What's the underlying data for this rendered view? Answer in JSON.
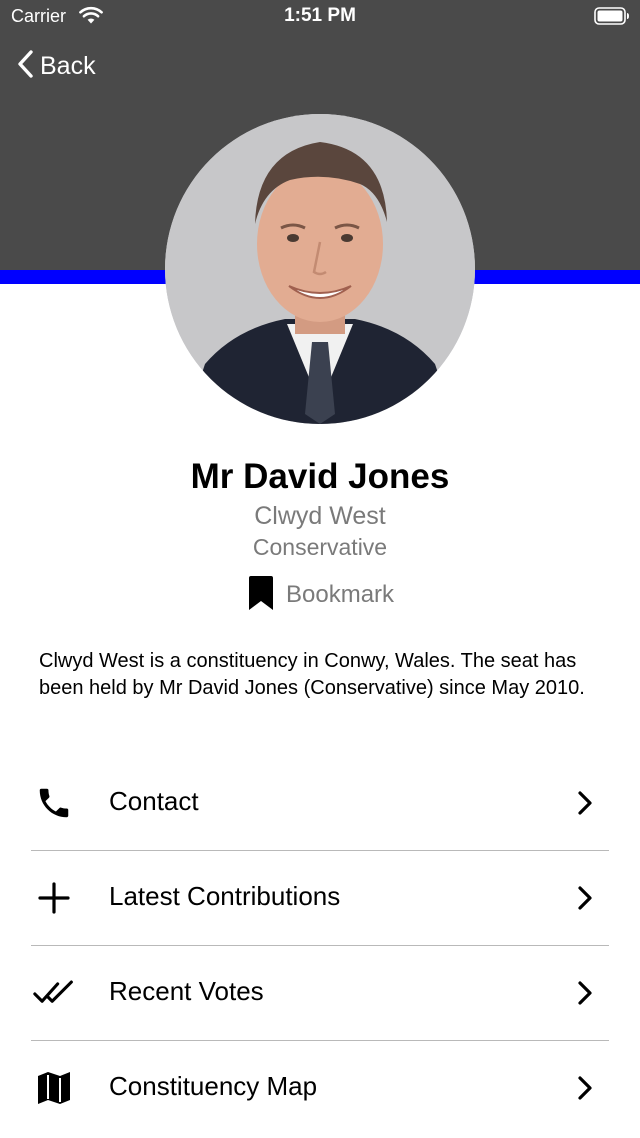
{
  "status_bar": {
    "carrier": "Carrier",
    "time": "1:51 PM"
  },
  "nav": {
    "back_label": "Back"
  },
  "theme": {
    "header_color": "#4a4a4a",
    "party_accent_color": "#0000ff"
  },
  "profile": {
    "name": "Mr David Jones",
    "constituency": "Clwyd West",
    "party": "Conservative",
    "bookmark_label": "Bookmark",
    "summary": "Clwyd West is a constituency in Conwy, Wales. The seat has been held by Mr David Jones (Conservative) since May 2010."
  },
  "menu": {
    "items": [
      {
        "label": "Contact",
        "icon": "phone-icon"
      },
      {
        "label": "Latest Contributions",
        "icon": "plus-icon"
      },
      {
        "label": "Recent Votes",
        "icon": "double-check-icon"
      },
      {
        "label": "Constituency Map",
        "icon": "map-icon"
      }
    ]
  }
}
